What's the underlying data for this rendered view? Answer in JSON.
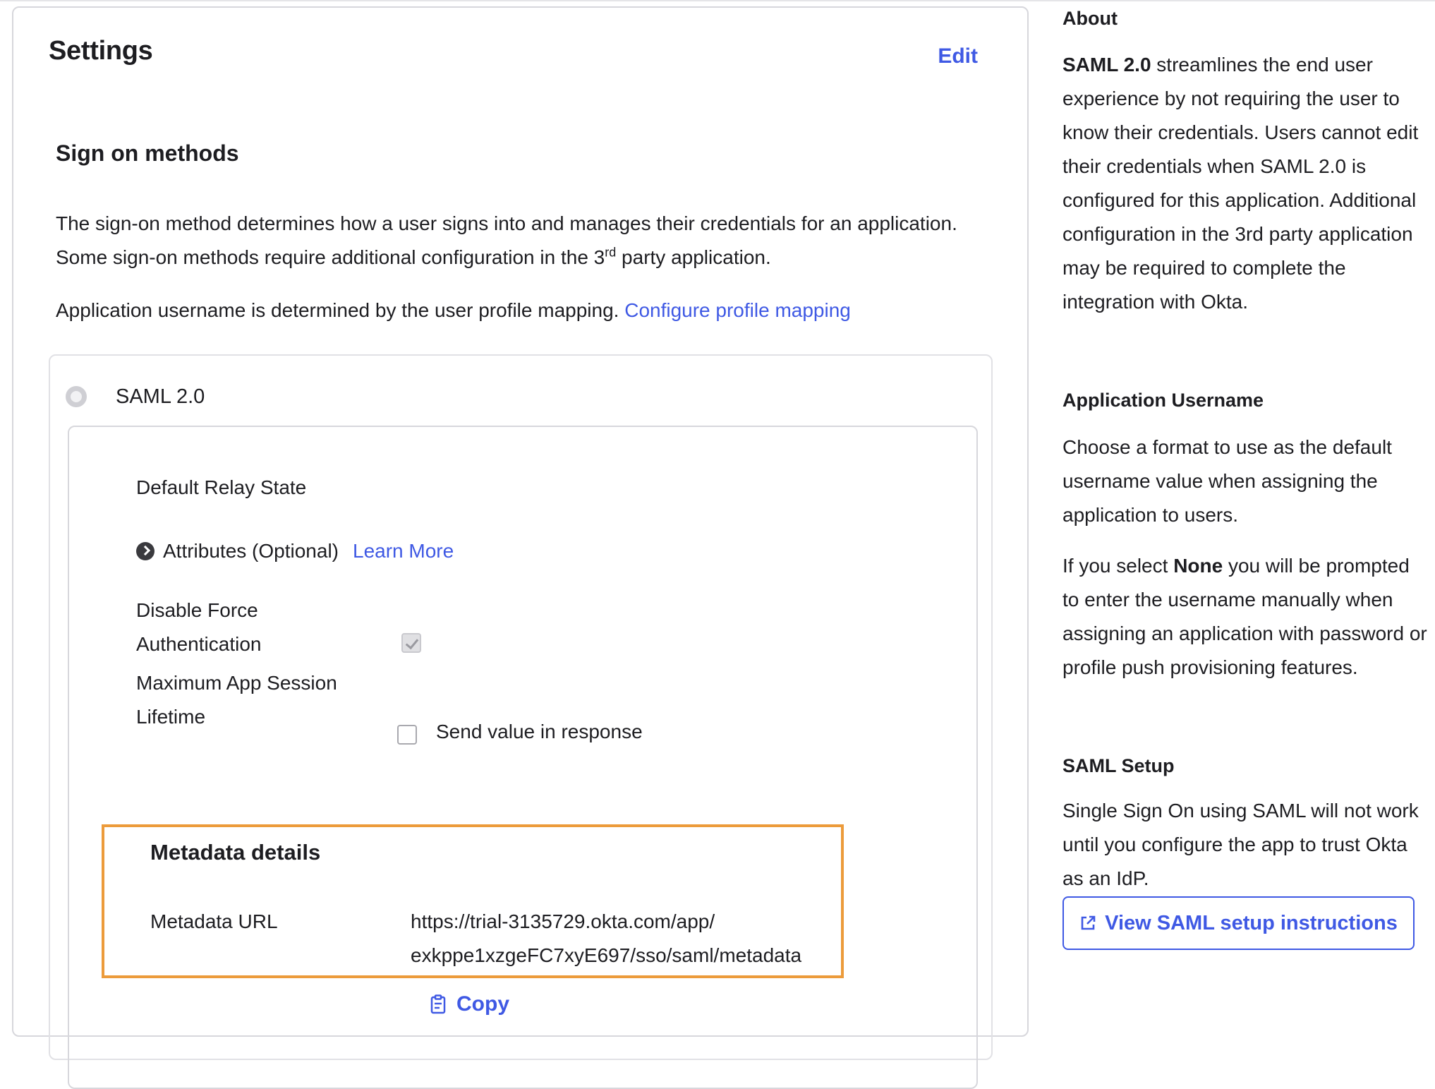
{
  "settings": {
    "title": "Settings",
    "edit_label": "Edit",
    "sign_on": {
      "title": "Sign on methods",
      "description_part1": "The sign-on method determines how a user signs into and manages their credentials for an application. Some sign-on methods require additional configuration in the 3",
      "description_sup": "rd",
      "description_part2": " party application.",
      "mapping_text": "Application username is determined by the user profile mapping.",
      "mapping_link": "Configure profile mapping"
    },
    "saml": {
      "method_label": "SAML 2.0",
      "default_relay_state": "Default Relay State",
      "attributes_label": "Attributes (Optional)",
      "learn_more": "Learn More",
      "disable_force_auth_line1": "Disable Force",
      "disable_force_auth_line2": "Authentication",
      "disable_force_auth_checked": true,
      "max_session_line1": "Maximum App Session",
      "max_session_line2": "Lifetime",
      "send_value_label": "Send value in response",
      "send_value_checked": false
    },
    "metadata": {
      "title": "Metadata details",
      "url_label": "Metadata URL",
      "url_line1": "https://trial-3135729.okta.com/app/",
      "url_line2": "exkppe1xzgeFC7xyE697/sso/saml/metadata",
      "copy_label": "Copy"
    }
  },
  "about": {
    "title": "About",
    "saml_bold": "SAML 2.0",
    "saml_text": " streamlines the end user experience by not requiring the user to know their credentials. Users cannot edit their credentials when SAML 2.0 is configured for this application. Additional configuration in the 3rd party application may be required to complete the integration with Okta.",
    "username_title": "Application Username",
    "username_text": "Choose a format to use as the default username value when assigning the application to users.",
    "none_prefix": "If you select ",
    "none_bold": "None",
    "none_suffix": " you will be prompted to enter the username manually when assigning an application with password or profile push provisioning features.",
    "setup_title": "SAML Setup",
    "setup_text": "Single Sign On using SAML will not work until you configure the app to trust Okta as an IdP.",
    "setup_button": "View SAML setup instructions"
  },
  "colors": {
    "accent": "#3f59e4",
    "highlight_box": "#ec9b3b"
  }
}
